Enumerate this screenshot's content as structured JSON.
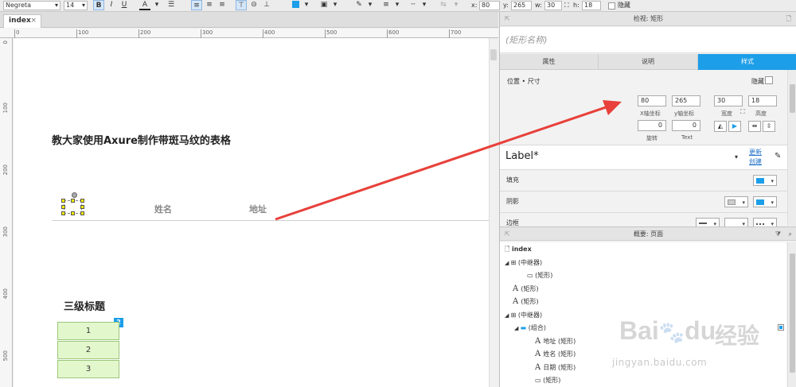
{
  "toolbar": {
    "font": "Negreta",
    "size": "14",
    "bold": "B",
    "italic": "I",
    "underline": "U",
    "font_color": "A",
    "x_label": "x:",
    "x": "80",
    "y_label": "y:",
    "y": "265",
    "w_label": "w:",
    "w": "30",
    "h_label": "h:",
    "h": "18",
    "hidden_label": "隐藏"
  },
  "tab": {
    "label": "index",
    "close": "×"
  },
  "ruler": {
    "h": [
      "0",
      "100",
      "200",
      "300",
      "400",
      "500",
      "600",
      "700"
    ],
    "v": [
      "0",
      "100",
      "200",
      "300",
      "400",
      "500"
    ]
  },
  "canvas": {
    "title": "教大家使用Axure制作带斑马纹的表格",
    "col1": "姓名",
    "col2": "地址",
    "subtitle": "三级标题",
    "badge": "2",
    "rows": [
      "1",
      "2",
      "3"
    ]
  },
  "inspector": {
    "header": "检视: 矩形",
    "name_placeholder": "(矩形名称)",
    "tabs": [
      "属性",
      "说明",
      "样式"
    ],
    "section": "位置 • 尺寸",
    "hidden_label": "隐藏",
    "x": "80",
    "y": "265",
    "w": "30",
    "h": "18",
    "x_label": "X轴坐标",
    "y_label": "y轴坐标",
    "w_label": "宽度",
    "h_label": "高度",
    "rotate": "0",
    "rotate_label": "旋转",
    "text_rotate": "0",
    "text_label": "Text",
    "style_name": "Label*",
    "update": "更新",
    "create": "创建",
    "fill": "填充",
    "shadow": "阴影",
    "border": "边框",
    "accent": "#1d9ee8"
  },
  "outline": {
    "header": "概要: 页面",
    "items": [
      {
        "icon": "page",
        "label": "index",
        "indent": 6,
        "bold": true
      },
      {
        "icon": "repeater",
        "label": "(中继器)",
        "indent": 6,
        "caret": "◢"
      },
      {
        "icon": "line",
        "label": "(矩形)",
        "indent": 34
      },
      {
        "icon": "text",
        "label": "(矩形)",
        "indent": 16
      },
      {
        "icon": "text",
        "label": "(矩形)",
        "indent": 16
      },
      {
        "icon": "repeater",
        "label": "(中继器)",
        "indent": 6,
        "caret": "◢"
      },
      {
        "icon": "folder",
        "label": "(组合)",
        "indent": 18,
        "caret": "◢"
      },
      {
        "icon": "text",
        "label": "地址 (矩形)",
        "indent": 44
      },
      {
        "icon": "text",
        "label": "姓名 (矩形)",
        "indent": 44
      },
      {
        "icon": "text",
        "label": "日期 (矩形)",
        "indent": 44
      },
      {
        "icon": "line",
        "label": "(矩形)",
        "indent": 44
      }
    ]
  },
  "watermark": {
    "brand": "Bai",
    "brand2": "du",
    "cn": "经验",
    "url": "jingyan.baidu.com"
  }
}
